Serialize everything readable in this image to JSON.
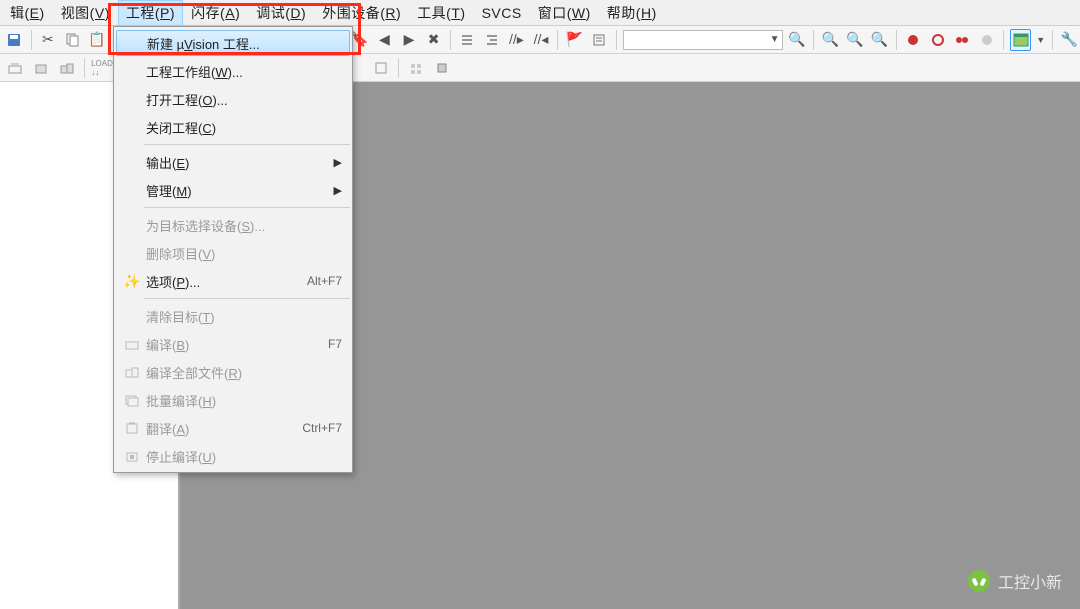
{
  "menubar": {
    "items": [
      {
        "label": "辑(E)"
      },
      {
        "label": "视图(V)"
      },
      {
        "label": "工程(P)"
      },
      {
        "label": "闪存(A)"
      },
      {
        "label": "调试(D)"
      },
      {
        "label": "外围设备(R)"
      },
      {
        "label": "工具(T)"
      },
      {
        "label": "SVCS"
      },
      {
        "label": "窗口(W)"
      },
      {
        "label": "帮助(H)"
      }
    ],
    "active_index": 2
  },
  "dropdown": {
    "items": [
      {
        "label": "新建 µVision 工程...",
        "highlight": true
      },
      {
        "label": "工程工作组(W)..."
      },
      {
        "label": "打开工程(O)..."
      },
      {
        "label": "关闭工程(C)"
      },
      {
        "sep": true
      },
      {
        "label": "输出(E)",
        "submenu": true
      },
      {
        "label": "管理(M)",
        "submenu": true
      },
      {
        "sep": true
      },
      {
        "label": "为目标选择设备(S)...",
        "disabled": true
      },
      {
        "label": "删除项目(V)",
        "disabled": true
      },
      {
        "label": "选项(P)...",
        "shortcut": "Alt+F7",
        "icon": "wand"
      },
      {
        "sep": true
      },
      {
        "label": "清除目标(T)",
        "disabled": true
      },
      {
        "label": "编译(B)",
        "shortcut": "F7",
        "disabled": true,
        "icon": "build"
      },
      {
        "label": "编译全部文件(R)",
        "disabled": true,
        "icon": "build-all"
      },
      {
        "label": "批量编译(H)",
        "disabled": true,
        "icon": "batch"
      },
      {
        "label": "翻译(A)",
        "shortcut": "Ctrl+F7",
        "disabled": true,
        "icon": "translate"
      },
      {
        "label": "停止编译(U)",
        "disabled": true,
        "icon": "stop"
      }
    ]
  },
  "watermark": {
    "text": "工控小新"
  }
}
